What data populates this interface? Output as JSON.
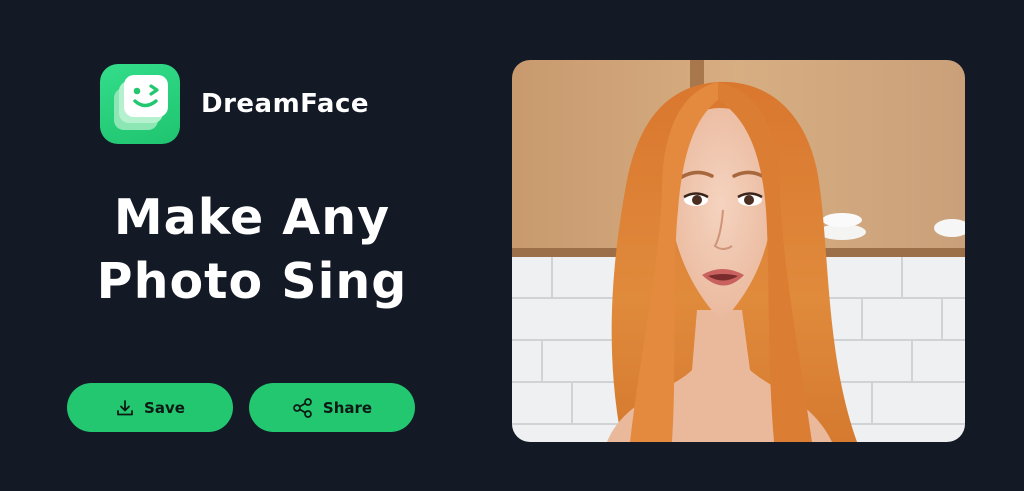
{
  "app": {
    "name": "DreamFace"
  },
  "headline": {
    "line1": "Make Any",
    "line2": "Photo Sing"
  },
  "actions": {
    "save_label": "Save",
    "share_label": "Share"
  },
  "icons": {
    "app_icon": "winking-face-icon",
    "save": "download-icon",
    "share": "share-icon"
  },
  "colors": {
    "background": "#141926",
    "accent": "#22c770",
    "text": "#ffffff"
  }
}
